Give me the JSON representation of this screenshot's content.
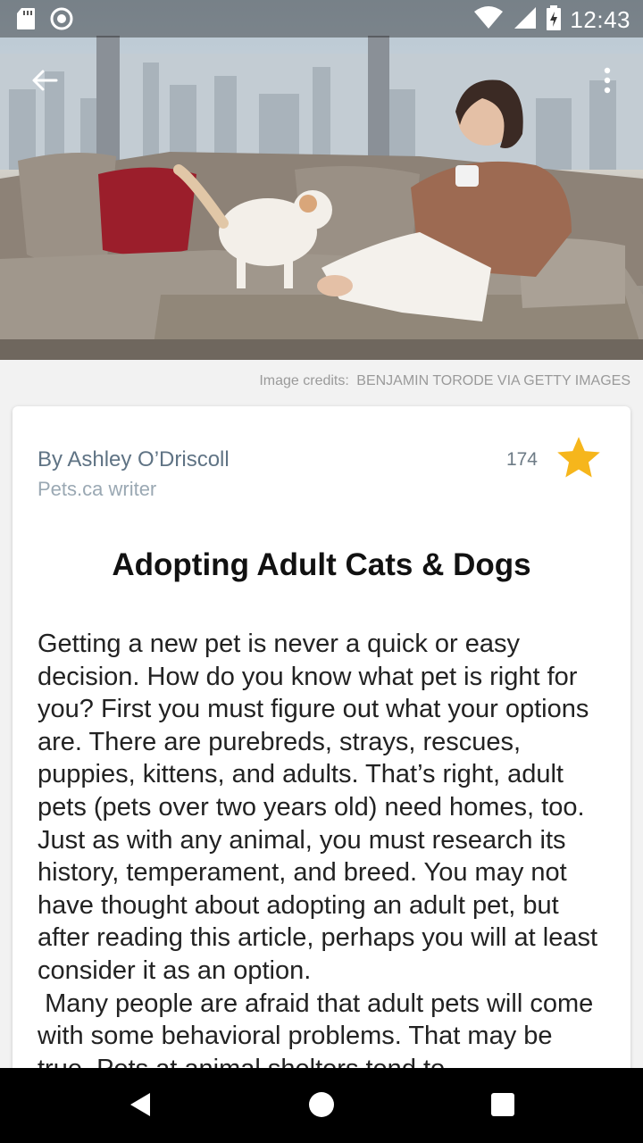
{
  "status_bar": {
    "time": "12:43",
    "icons": [
      "sd-card-icon",
      "circle-notification-icon",
      "wifi-icon",
      "signal-icon",
      "battery-charging-icon"
    ]
  },
  "app_bar": {
    "back_icon": "arrow-left-icon",
    "more_icon": "more-vertical-icon"
  },
  "image_credits": {
    "label": "Image credits:",
    "value": "BENJAMIN TORODE VIA GETTY IMAGES"
  },
  "article": {
    "author": "By Ashley O’Driscoll",
    "role": "Pets.ca writer",
    "favorites_count": "174",
    "star_color": "#f6b61c",
    "title": "Adopting Adult Cats & Dogs",
    "paragraph_1": "Getting a new pet is never a quick or easy decision. How do you know what pet is right for you? First you must figure out what your options are. There are purebreds, strays, rescues, puppies, kittens, and adults. That’s right, adult pets (pets over two years old) need homes, too. Just as with any animal, you must research its history, temperament, and breed. You may not have thought about adopting an adult pet, but after reading this article, perhaps you will at least consider it as an option.",
    "paragraph_2": " Many people are afraid that adult pets will come with some behavioral problems. That may be true. Pets at animal shelters tend to"
  },
  "nav_bar": {
    "back_icon": "triangle-back-icon",
    "home_icon": "circle-home-icon",
    "recents_icon": "square-recents-icon"
  }
}
